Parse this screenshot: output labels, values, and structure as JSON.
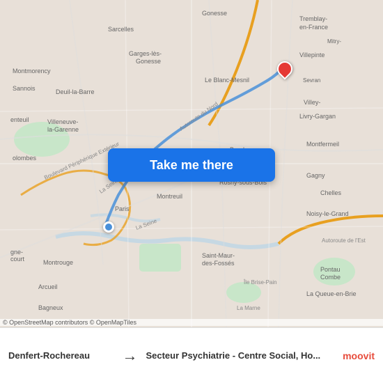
{
  "map": {
    "button_label": "Take me there",
    "attribution": "© OpenStreetMap contributors © OpenMapTiles",
    "origin_name": "Denfert-Rochereau",
    "destination_name": "Secteur Psychiatrie - Centre Social, Ho...",
    "arrow": "→"
  },
  "moovit": {
    "logo_text": "moovit"
  },
  "colors": {
    "button_bg": "#1a73e8",
    "button_text": "#ffffff",
    "origin_marker": "#4a90d9",
    "destination_marker": "#e53935",
    "route_line": "#4a90d9"
  }
}
